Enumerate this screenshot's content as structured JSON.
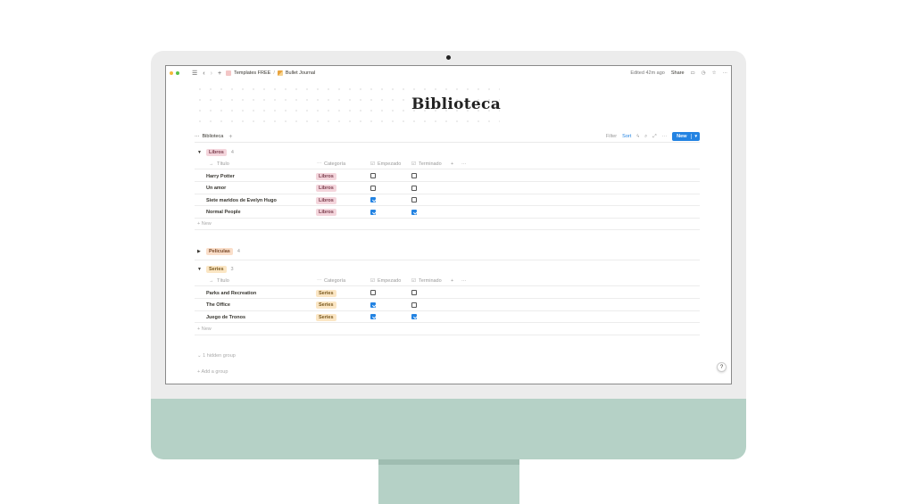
{
  "topbar": {
    "breadcrumb": [
      "Templates FREE",
      "/",
      "Bullet Journal"
    ],
    "edited": "Edited 42m ago",
    "share": "Share"
  },
  "page": {
    "title": "Biblioteca"
  },
  "view": {
    "tab_label": "Biblioteca",
    "filter": "Filter",
    "sort": "Sort",
    "new": "New"
  },
  "columns": {
    "title": "Título",
    "category": "Categoría",
    "started": "Empezado",
    "finished": "Terminado"
  },
  "groups": {
    "libros": {
      "label": "Libros",
      "count": "4",
      "rows": [
        {
          "title": "Harry Potter",
          "category": "Libros",
          "started": false,
          "finished": false
        },
        {
          "title": "Un amor",
          "category": "Libros",
          "started": false,
          "finished": false
        },
        {
          "title": "Siete maridos de Evelyn Hugo",
          "category": "Libros",
          "started": true,
          "finished": false
        },
        {
          "title": "Normal People",
          "category": "Libros",
          "started": true,
          "finished": true
        }
      ]
    },
    "peliculas": {
      "label": "Peliculas",
      "count": "4"
    },
    "series": {
      "label": "Series",
      "count": "3",
      "rows": [
        {
          "title": "Parks and Recreation",
          "category": "Series",
          "started": false,
          "finished": false
        },
        {
          "title": "The Office",
          "category": "Series",
          "started": true,
          "finished": false
        },
        {
          "title": "Juego de Tronos",
          "category": "Series",
          "started": true,
          "finished": true
        }
      ]
    }
  },
  "new_row": "New",
  "hidden_group": "1 hidden group",
  "add_group": "Add a group",
  "help": "?",
  "colors": {
    "accent": "#2383e2",
    "monitor_chin": "#b5d1c6",
    "tag_libros": "#f4d5dc",
    "tag_peliculas": "#fadec9",
    "tag_series": "#fbe6c4"
  }
}
